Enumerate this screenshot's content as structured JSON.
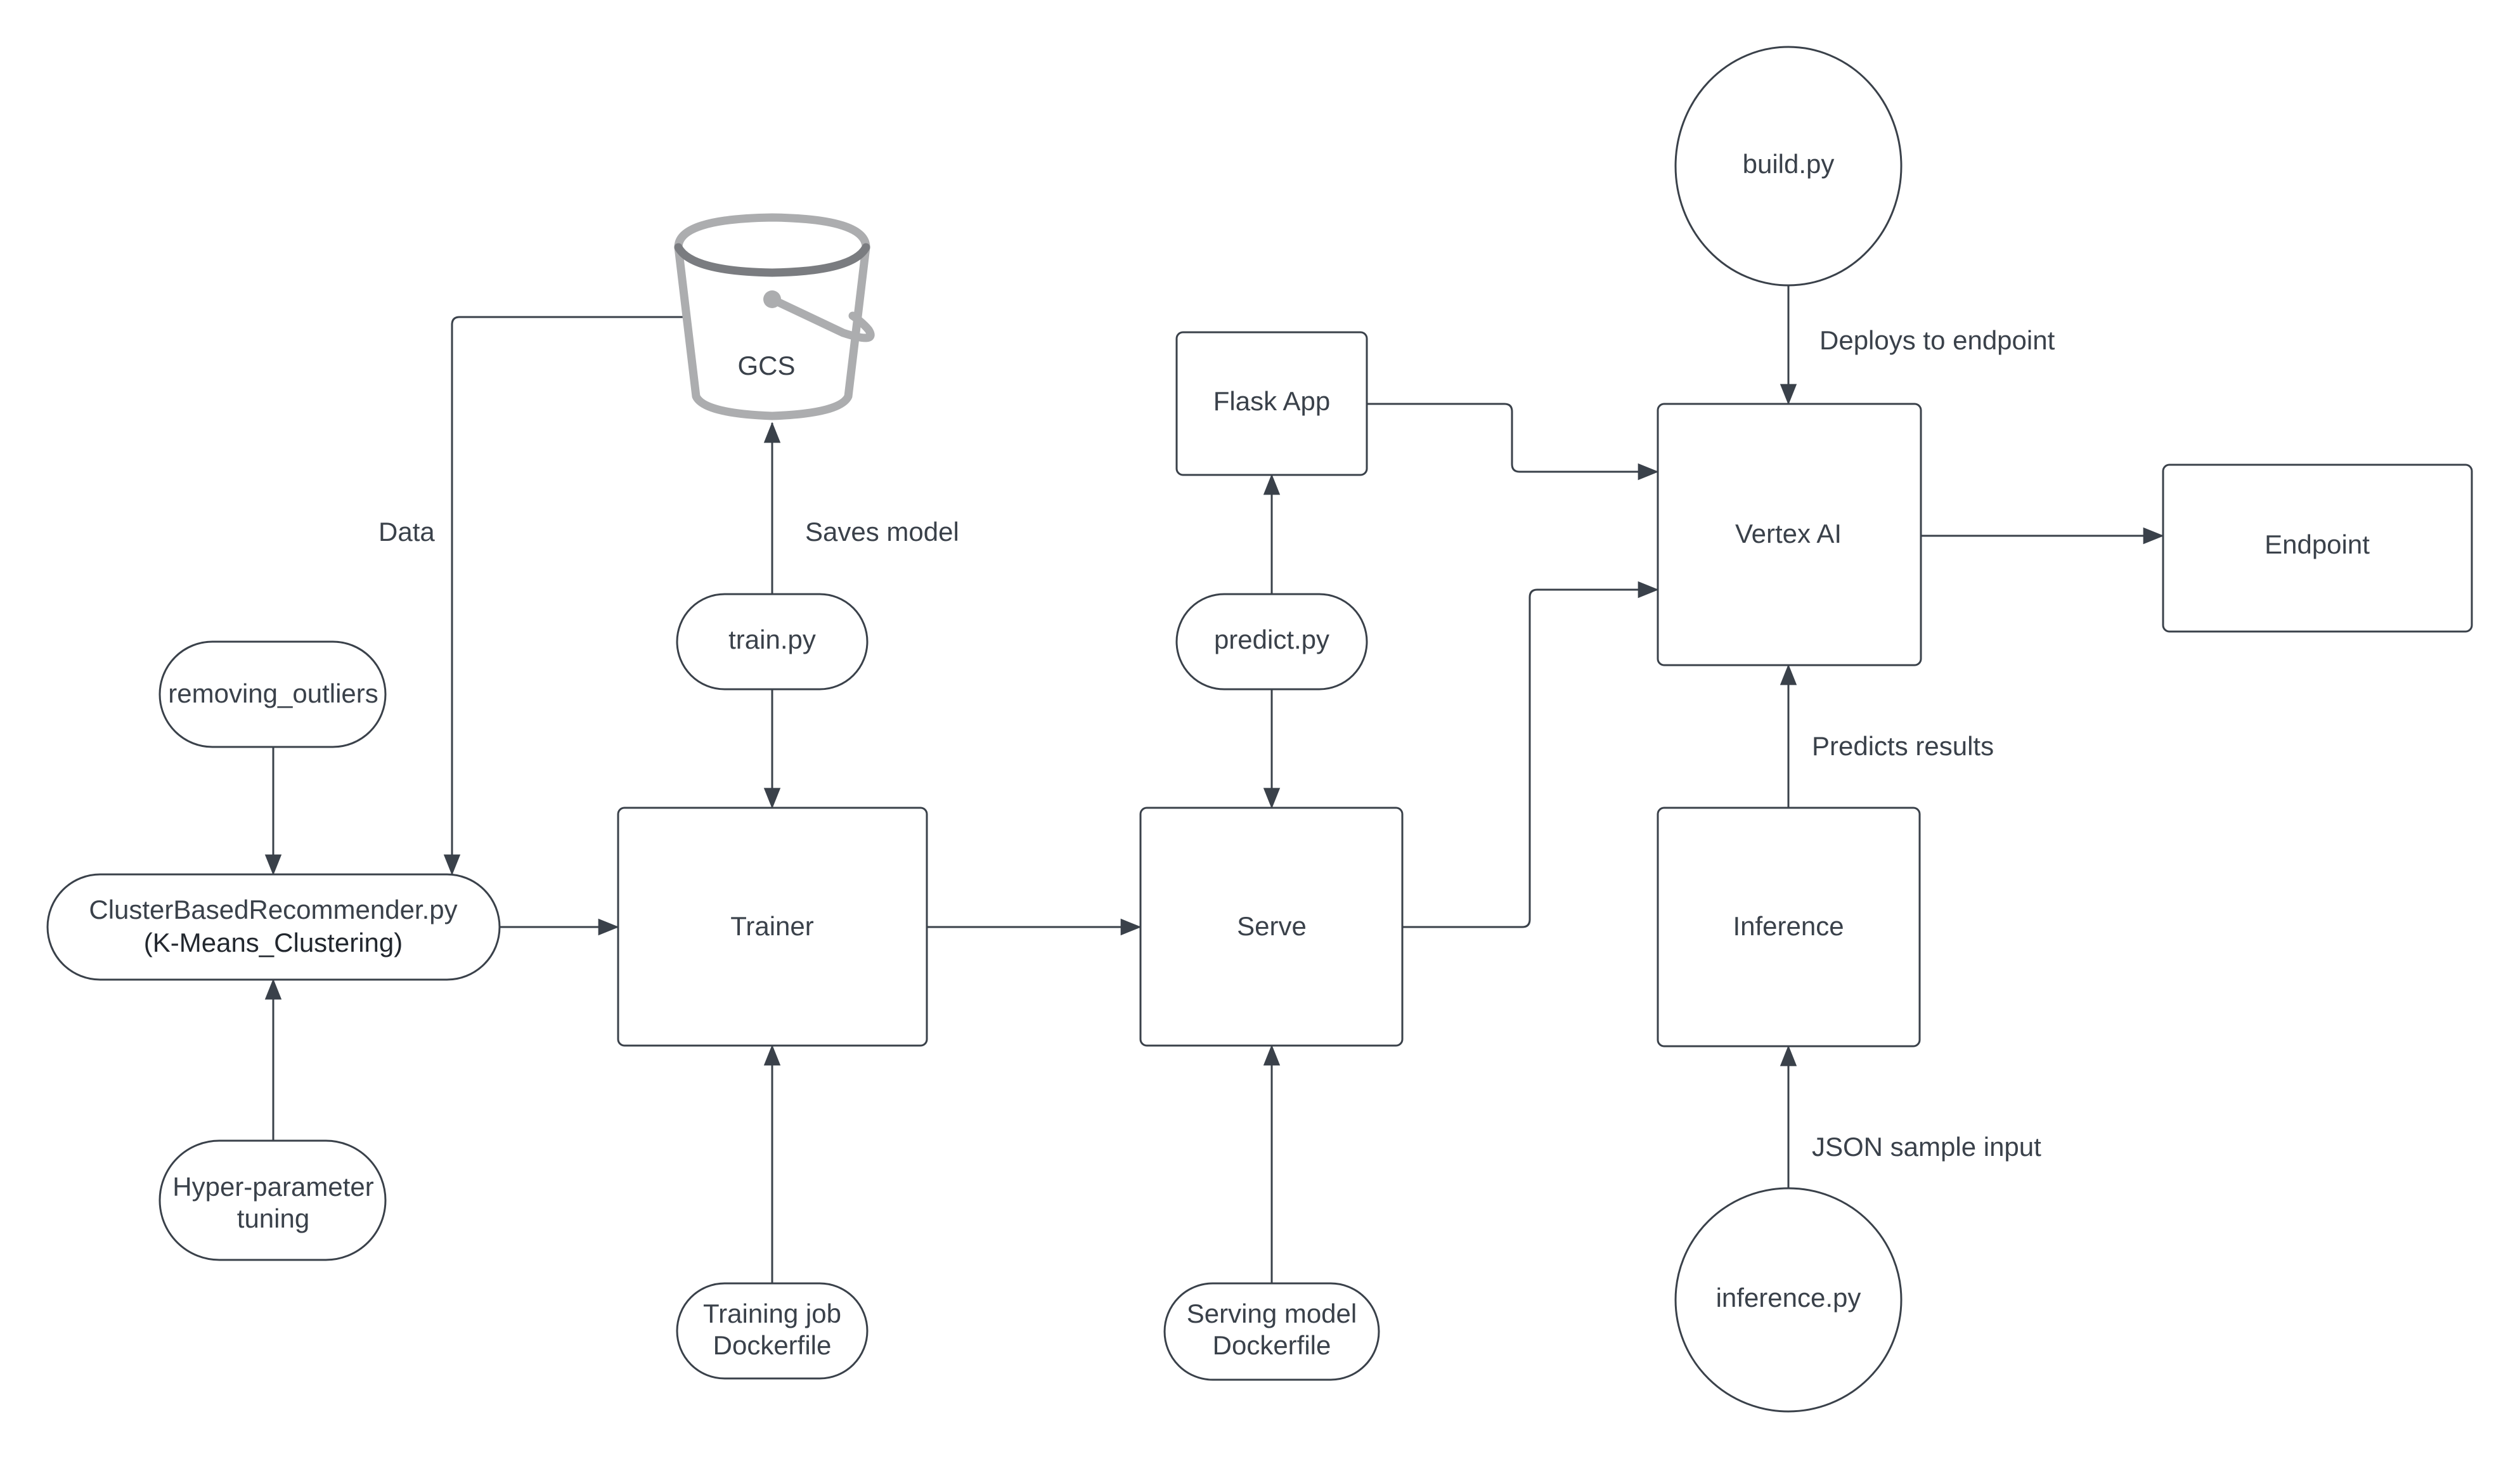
{
  "diagram": {
    "colors": {
      "stroke": "#3a414a",
      "text": "#3a414a",
      "background": "#ffffff",
      "bucket_light": "#acadaf",
      "bucket_dark": "#7a7c80"
    },
    "nodes": {
      "gcs": {
        "label": "GCS",
        "shape": "bucket",
        "icon": "storage-bucket-icon"
      },
      "removing_outliers": {
        "label": "removing_outliers",
        "shape": "pill"
      },
      "cluster": {
        "line1": "ClusterBasedRecommender.py",
        "line2": "(K-Means_Clustering)",
        "shape": "pill"
      },
      "hyperparam": {
        "line1": "Hyper-parameter",
        "line2": "tuning",
        "shape": "pill"
      },
      "train_py": {
        "label": "train.py",
        "shape": "pill"
      },
      "trainer": {
        "label": "Trainer",
        "shape": "rounded-rect"
      },
      "training_dockerfile": {
        "line1": "Training job",
        "line2": "Dockerfile",
        "shape": "pill"
      },
      "flask_app": {
        "label": "Flask App",
        "shape": "rounded-rect"
      },
      "predict_py": {
        "label": "predict.py",
        "shape": "pill"
      },
      "serve": {
        "label": "Serve",
        "shape": "rounded-rect"
      },
      "serving_dockerfile": {
        "line1": "Serving model",
        "line2": "Dockerfile",
        "shape": "pill"
      },
      "build_py": {
        "label": "build.py",
        "shape": "circle"
      },
      "vertex_ai": {
        "label": "Vertex AI",
        "shape": "rounded-rect"
      },
      "endpoint": {
        "label": "Endpoint",
        "shape": "rounded-rect"
      },
      "inference": {
        "label": "Inference",
        "shape": "rounded-rect"
      },
      "inference_py": {
        "label": "inference.py",
        "shape": "circle"
      }
    },
    "edges": [
      {
        "from": "gcs",
        "to": "cluster",
        "label": "Data"
      },
      {
        "from": "removing_outliers",
        "to": "cluster",
        "label": ""
      },
      {
        "from": "hyperparam",
        "to": "cluster",
        "label": ""
      },
      {
        "from": "cluster",
        "to": "trainer",
        "label": ""
      },
      {
        "from": "train_py",
        "to": "gcs",
        "label": "Saves model"
      },
      {
        "from": "train_py",
        "to": "trainer",
        "label": ""
      },
      {
        "from": "training_dockerfile",
        "to": "trainer",
        "label": ""
      },
      {
        "from": "trainer",
        "to": "serve",
        "label": ""
      },
      {
        "from": "predict_py",
        "to": "flask_app",
        "label": ""
      },
      {
        "from": "predict_py",
        "to": "serve",
        "label": ""
      },
      {
        "from": "serving_dockerfile",
        "to": "serve",
        "label": ""
      },
      {
        "from": "flask_app",
        "to": "vertex_ai",
        "label": ""
      },
      {
        "from": "serve",
        "to": "vertex_ai",
        "label": ""
      },
      {
        "from": "build_py",
        "to": "vertex_ai",
        "label": "Deploys to endpoint"
      },
      {
        "from": "vertex_ai",
        "to": "endpoint",
        "label": ""
      },
      {
        "from": "inference",
        "to": "vertex_ai",
        "label": "Predicts results"
      },
      {
        "from": "inference_py",
        "to": "inference",
        "label": "JSON sample input"
      }
    ],
    "edge_labels": {
      "data": "Data",
      "saves_model": "Saves model",
      "deploys_to_endpoint": "Deploys to endpoint",
      "predicts_results": "Predicts results",
      "json_sample_input": "JSON sample input"
    }
  }
}
